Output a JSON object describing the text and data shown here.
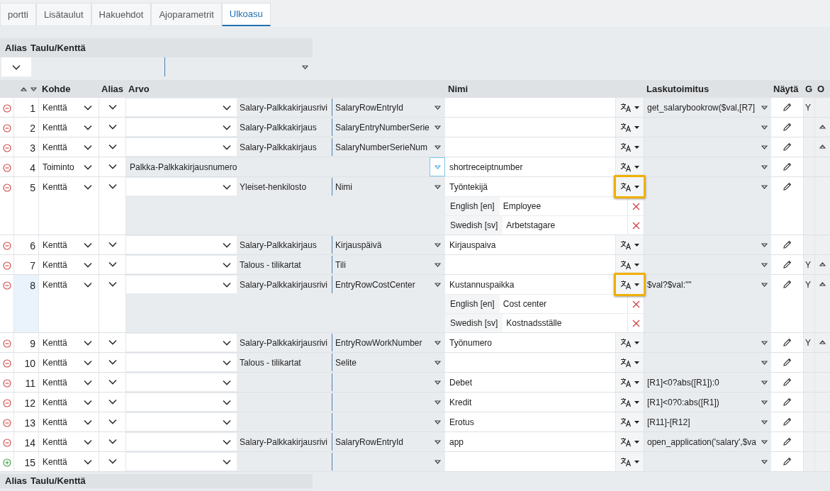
{
  "tabs": [
    {
      "label": "portti",
      "selected": false
    },
    {
      "label": "Lisätaulut",
      "selected": false
    },
    {
      "label": "Hakuehdot",
      "selected": false
    },
    {
      "label": "Ajoparametrit",
      "selected": false
    },
    {
      "label": "Ulkoasu",
      "selected": true
    }
  ],
  "alias_panel": {
    "columns": [
      "Alias",
      "Taulu/Kenttä"
    ]
  },
  "table": {
    "columns": [
      "Kohde",
      "Alias",
      "Arvo",
      "Nimi",
      "Laskutoimitus",
      "Näytä",
      "G",
      "O"
    ],
    "rows": [
      {
        "kind": "remove",
        "number": "1",
        "target": "Kenttä",
        "source": {
          "kind": "field",
          "table": "Salary-Palkkakirjausrivi",
          "field": "SalaryRowEntryId",
          "focused": false
        },
        "calc": "get_salarybookrow($val,[R7]",
        "g": "Y",
        "o": false,
        "selected": false,
        "highlighted": false,
        "translations": []
      },
      {
        "kind": "remove",
        "number": "2",
        "target": "Kenttä",
        "source": {
          "kind": "field",
          "table": "Salary-Palkkakirjaus",
          "field": "SalaryEntryNumberSerie",
          "focused": false
        },
        "o": true,
        "selected": false,
        "highlighted": false,
        "translations": []
      },
      {
        "kind": "remove",
        "number": "3",
        "target": "Kenttä",
        "source": {
          "kind": "field",
          "table": "Salary-Palkkakirjaus",
          "field": "SalaryNumberSerieNum",
          "focused": false
        },
        "o": true,
        "selected": false,
        "highlighted": false,
        "translations": []
      },
      {
        "kind": "remove",
        "number": "4",
        "target": "Toiminto",
        "source": {
          "kind": "function",
          "text": "Palkka-Palkkakirjausnumero",
          "focused": true
        },
        "name": "shortreceiptnumber",
        "o": false,
        "selected": false,
        "highlighted": false,
        "translations": []
      },
      {
        "kind": "remove",
        "number": "5",
        "target": "Kenttä",
        "source": {
          "kind": "field",
          "table": "Yleiset-henkilosto",
          "field": "Nimi",
          "focused": false
        },
        "name": "Työntekijä",
        "o": false,
        "selected": false,
        "highlighted": true,
        "translations": [
          {
            "language": "English [en]",
            "text": "Employee"
          },
          {
            "language": "Swedish [sv]",
            "text": "Arbetstagare"
          }
        ]
      },
      {
        "kind": "remove",
        "number": "6",
        "target": "Kenttä",
        "source": {
          "kind": "field",
          "table": "Salary-Palkkakirjaus",
          "field": "Kirjauspäivä",
          "focused": false
        },
        "name": "Kirjauspaiva",
        "o": false,
        "selected": false,
        "highlighted": false,
        "translations": []
      },
      {
        "kind": "remove",
        "number": "7",
        "target": "Kenttä",
        "source": {
          "kind": "field",
          "table": "Talous - tilikartat",
          "field": "Tili",
          "focused": false
        },
        "g": "Y",
        "o": true,
        "selected": false,
        "highlighted": false,
        "translations": []
      },
      {
        "kind": "remove",
        "number": "8",
        "target": "Kenttä",
        "source": {
          "kind": "field",
          "table": "Salary-Palkkakirjausrivi",
          "field": "EntryRowCostCenter",
          "focused": false
        },
        "name": "Kustannuspaikka",
        "calc": "$val?$val:\"\"",
        "g": "Y",
        "o": true,
        "selected": true,
        "highlighted": true,
        "translations": [
          {
            "language": "English [en]",
            "text": "Cost center"
          },
          {
            "language": "Swedish [sv]",
            "text": "Kostnadsställe"
          }
        ]
      },
      {
        "kind": "remove",
        "number": "9",
        "target": "Kenttä",
        "source": {
          "kind": "field",
          "table": "Salary-Palkkakirjausrivi",
          "field": "EntryRowWorkNumber",
          "focused": false
        },
        "name": "Työnumero",
        "g": "Y",
        "o": true,
        "selected": false,
        "highlighted": false,
        "translations": []
      },
      {
        "kind": "remove",
        "number": "10",
        "target": "Kenttä",
        "source": {
          "kind": "field",
          "table": "Talous - tilikartat",
          "field": "Selite",
          "focused": false
        },
        "o": false,
        "selected": false,
        "highlighted": false,
        "translations": []
      },
      {
        "kind": "remove",
        "number": "11",
        "target": "Kenttä",
        "source": {
          "kind": "field",
          "focused": false
        },
        "name": "Debet",
        "calc": "[R1]<0?abs([R1]):0",
        "o": false,
        "selected": false,
        "highlighted": false,
        "translations": []
      },
      {
        "kind": "remove",
        "number": "12",
        "target": "Kenttä",
        "source": {
          "kind": "field",
          "focused": false
        },
        "name": "Kredit",
        "calc": "[R1]<0?0:abs([R1])",
        "o": false,
        "selected": false,
        "highlighted": false,
        "translations": []
      },
      {
        "kind": "remove",
        "number": "13",
        "target": "Kenttä",
        "source": {
          "kind": "field",
          "focused": false
        },
        "name": "Erotus",
        "calc": "[R11]-[R12]",
        "o": false,
        "selected": false,
        "highlighted": false,
        "translations": []
      },
      {
        "kind": "remove",
        "number": "14",
        "target": "Kenttä",
        "source": {
          "kind": "field",
          "table": "Salary-Palkkakirjausrivi",
          "field": "SalaryRowEntryId",
          "focused": false
        },
        "name": "app",
        "calc": "open_application('salary',$va",
        "o": false,
        "selected": false,
        "highlighted": false,
        "translations": []
      },
      {
        "kind": "add",
        "number": "15",
        "target": "Kenttä",
        "source": {
          "kind": "field",
          "focused": false
        },
        "o": false,
        "selected": false,
        "highlighted": false,
        "translations": []
      }
    ]
  },
  "bottom_panel": {
    "columns": [
      "Alias",
      "Taulu/Kenttä"
    ]
  }
}
